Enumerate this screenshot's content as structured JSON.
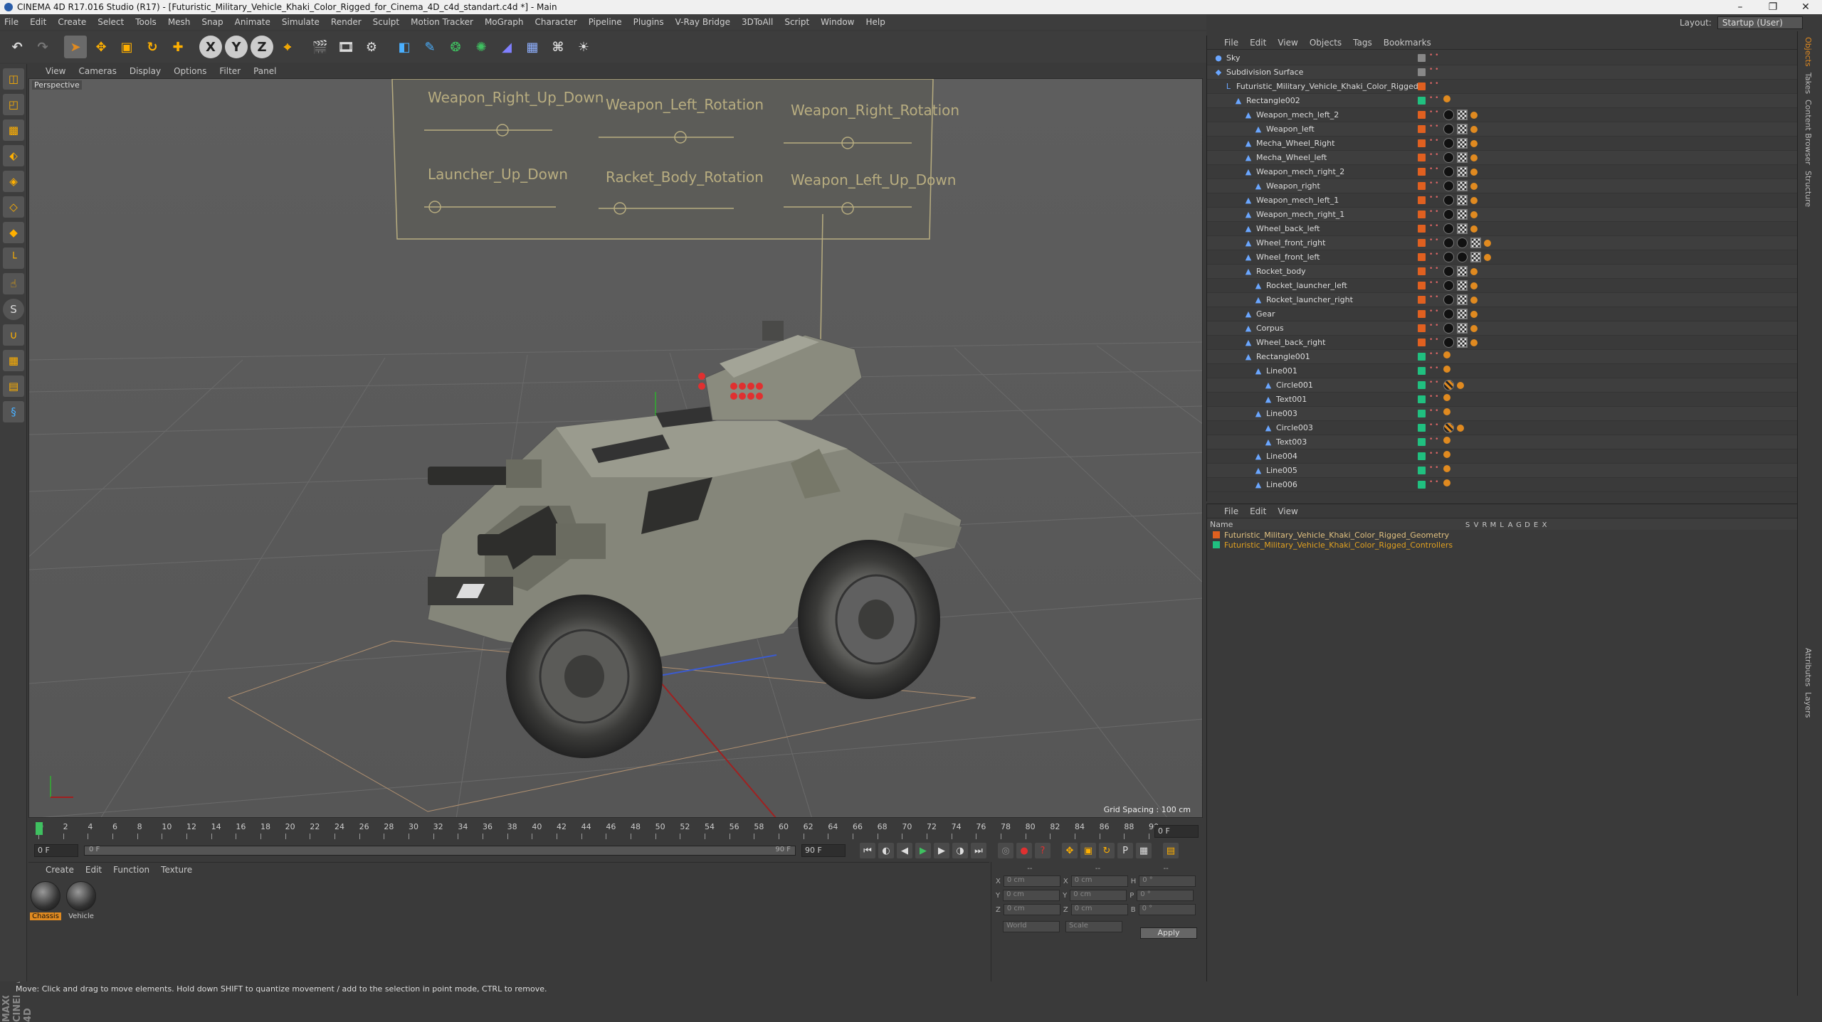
{
  "window": {
    "title": "CINEMA 4D R17.016 Studio (R17) - [Futuristic_Military_Vehicle_Khaki_Color_Rigged_for_Cinema_4D_c4d_standart.c4d *] - Main",
    "controls": [
      "–",
      "❐",
      "✕"
    ]
  },
  "menubar": [
    "File",
    "Edit",
    "Create",
    "Select",
    "Tools",
    "Mesh",
    "Snap",
    "Animate",
    "Simulate",
    "Render",
    "Sculpt",
    "Motion Tracker",
    "MoGraph",
    "Character",
    "Pipeline",
    "Plugins",
    "V-Ray Bridge",
    "3DToAll",
    "Script",
    "Window",
    "Help"
  ],
  "layout": {
    "label": "Layout:",
    "value": "Startup (User)"
  },
  "toolbar": {
    "buttons": [
      "undo-icon",
      "redo-icon",
      "select-icon",
      "move-icon",
      "scale-icon",
      "rotate-icon",
      "create-icon",
      "x-axis-icon",
      "y-axis-icon",
      "z-axis-icon",
      "world-icon",
      "render-view-icon",
      "render-pic-icon",
      "render-settings-icon",
      "cube-icon",
      "pen-icon",
      "subdivide-icon",
      "array-icon",
      "deformer-icon",
      "floor-icon",
      "camera-icon",
      "light-icon"
    ],
    "axis_labels": [
      "X",
      "Y",
      "Z"
    ]
  },
  "viewport": {
    "menu": [
      "View",
      "Cameras",
      "Display",
      "Options",
      "Filter",
      "Panel"
    ],
    "label": "Perspective",
    "grid_spacing": "Grid Spacing : 100 cm",
    "hud_controls": [
      "Weapon_Right_Up_Down",
      "Weapon_Left_Rotation",
      "Weapon_Right_Rotation",
      "Launcher_Up_Down",
      "Racket_Body_Rotation",
      "Weapon_Left_Up_Down"
    ]
  },
  "timeline": {
    "ticks": [
      "0",
      "2",
      "4",
      "6",
      "8",
      "10",
      "12",
      "14",
      "16",
      "18",
      "20",
      "22",
      "24",
      "26",
      "28",
      "30",
      "32",
      "34",
      "36",
      "38",
      "40",
      "42",
      "44",
      "46",
      "48",
      "50",
      "52",
      "54",
      "56",
      "58",
      "60",
      "62",
      "64",
      "66",
      "68",
      "70",
      "72",
      "74",
      "76",
      "78",
      "80",
      "82",
      "84",
      "86",
      "88",
      "90"
    ],
    "current_frame": "0 F",
    "start_frame": "0 F",
    "range_start": "0 F",
    "range_end": "90 F",
    "end_frame": "90 F"
  },
  "materials": {
    "menu": [
      "Create",
      "Edit",
      "Function",
      "Texture"
    ],
    "items": [
      {
        "name": "Chassis",
        "selected": true
      },
      {
        "name": "Vehicle",
        "selected": false
      }
    ]
  },
  "coordinates": {
    "header": [
      "--",
      "--",
      "--"
    ],
    "rows": [
      {
        "a": "X",
        "av": "0 cm",
        "b": "X",
        "bv": "0 cm",
        "c": "H",
        "cv": "0 °"
      },
      {
        "a": "Y",
        "av": "0 cm",
        "b": "Y",
        "bv": "0 cm",
        "c": "P",
        "cv": "0 °"
      },
      {
        "a": "Z",
        "av": "0 cm",
        "b": "Z",
        "bv": "0 cm",
        "c": "B",
        "cv": "0 °"
      }
    ],
    "mode1": "World",
    "mode2": "Scale",
    "apply": "Apply"
  },
  "status": "Move: Click and drag to move elements. Hold down SHIFT to quantize movement / add to the selection in point mode, CTRL to remove.",
  "object_manager": {
    "menu": [
      "File",
      "Edit",
      "View",
      "Objects",
      "Tags",
      "Bookmarks"
    ],
    "objects": [
      {
        "name": "Sky",
        "indent": 0,
        "icon": "●",
        "vis": "#888",
        "tags": []
      },
      {
        "name": "Subdivision Surface",
        "indent": 0,
        "icon": "◆",
        "vis": "#888",
        "tags": []
      },
      {
        "name": "Futuristic_Military_Vehicle_Khaki_Color_Rigged",
        "indent": 1,
        "icon": "L",
        "vis": "#e06020",
        "tags": []
      },
      {
        "name": "Rectangle002",
        "indent": 2,
        "icon": "▲",
        "vis": "#20c080",
        "tags": [
          "orange"
        ]
      },
      {
        "name": "Weapon_mech_left_2",
        "indent": 3,
        "icon": "▲",
        "vis": "#e06020",
        "tags": [
          "ball",
          "check",
          "orange"
        ]
      },
      {
        "name": "Weapon_left",
        "indent": 4,
        "icon": "▲",
        "vis": "#e06020",
        "tags": [
          "ball",
          "check",
          "orange"
        ]
      },
      {
        "name": "Mecha_Wheel_Right",
        "indent": 3,
        "icon": "▲",
        "vis": "#e06020",
        "tags": [
          "ball",
          "check",
          "orange"
        ]
      },
      {
        "name": "Mecha_Wheel_left",
        "indent": 3,
        "icon": "▲",
        "vis": "#e06020",
        "tags": [
          "ball",
          "check",
          "orange"
        ]
      },
      {
        "name": "Weapon_mech_right_2",
        "indent": 3,
        "icon": "▲",
        "vis": "#e06020",
        "tags": [
          "ball",
          "check",
          "orange"
        ]
      },
      {
        "name": "Weapon_right",
        "indent": 4,
        "icon": "▲",
        "vis": "#e06020",
        "tags": [
          "ball",
          "check",
          "orange"
        ]
      },
      {
        "name": "Weapon_mech_left_1",
        "indent": 3,
        "icon": "▲",
        "vis": "#e06020",
        "tags": [
          "ball",
          "check",
          "orange"
        ]
      },
      {
        "name": "Weapon_mech_right_1",
        "indent": 3,
        "icon": "▲",
        "vis": "#e06020",
        "tags": [
          "ball",
          "check",
          "orange"
        ]
      },
      {
        "name": "Wheel_back_left",
        "indent": 3,
        "icon": "▲",
        "vis": "#e06020",
        "tags": [
          "ball",
          "check",
          "orange"
        ]
      },
      {
        "name": "Wheel_front_right",
        "indent": 3,
        "icon": "▲",
        "vis": "#e06020",
        "tags": [
          "ball",
          "ball",
          "check",
          "orange"
        ]
      },
      {
        "name": "Wheel_front_left",
        "indent": 3,
        "icon": "▲",
        "vis": "#e06020",
        "tags": [
          "ball",
          "ball",
          "check",
          "orange"
        ]
      },
      {
        "name": "Rocket_body",
        "indent": 3,
        "icon": "▲",
        "vis": "#e06020",
        "tags": [
          "ball",
          "check",
          "orange"
        ]
      },
      {
        "name": "Rocket_launcher_left",
        "indent": 4,
        "icon": "▲",
        "vis": "#e06020",
        "tags": [
          "ball",
          "check",
          "orange"
        ]
      },
      {
        "name": "Rocket_launcher_right",
        "indent": 4,
        "icon": "▲",
        "vis": "#e06020",
        "tags": [
          "ball",
          "check",
          "orange"
        ]
      },
      {
        "name": "Gear",
        "indent": 3,
        "icon": "▲",
        "vis": "#e06020",
        "tags": [
          "ball",
          "check",
          "orange"
        ]
      },
      {
        "name": "Corpus",
        "indent": 3,
        "icon": "▲",
        "vis": "#e06020",
        "tags": [
          "ball",
          "check",
          "orange"
        ]
      },
      {
        "name": "Wheel_back_right",
        "indent": 3,
        "icon": "▲",
        "vis": "#e06020",
        "tags": [
          "ball",
          "check",
          "orange"
        ]
      },
      {
        "name": "Rectangle001",
        "indent": 3,
        "icon": "▲",
        "vis": "#20c080",
        "tags": [
          "orange"
        ]
      },
      {
        "name": "Line001",
        "indent": 4,
        "icon": "▲",
        "vis": "#20c080",
        "tags": [
          "orange"
        ]
      },
      {
        "name": "Circle001",
        "indent": 5,
        "icon": "▲",
        "vis": "#20c080",
        "tags": [
          "stripe",
          "orange"
        ]
      },
      {
        "name": "Text001",
        "indent": 5,
        "icon": "▲",
        "vis": "#20c080",
        "tags": [
          "orange"
        ]
      },
      {
        "name": "Line003",
        "indent": 4,
        "icon": "▲",
        "vis": "#20c080",
        "tags": [
          "orange"
        ]
      },
      {
        "name": "Circle003",
        "indent": 5,
        "icon": "▲",
        "vis": "#20c080",
        "tags": [
          "stripe",
          "orange"
        ]
      },
      {
        "name": "Text003",
        "indent": 5,
        "icon": "▲",
        "vis": "#20c080",
        "tags": [
          "orange"
        ]
      },
      {
        "name": "Line004",
        "indent": 4,
        "icon": "▲",
        "vis": "#20c080",
        "tags": [
          "orange"
        ]
      },
      {
        "name": "Line005",
        "indent": 4,
        "icon": "▲",
        "vis": "#20c080",
        "tags": [
          "orange"
        ]
      },
      {
        "name": "Line006",
        "indent": 4,
        "icon": "▲",
        "vis": "#20c080",
        "tags": [
          "orange"
        ]
      }
    ]
  },
  "layer_manager": {
    "menu": [
      "File",
      "Edit",
      "View"
    ],
    "header_name": "Name",
    "columns": [
      "S",
      "V",
      "R",
      "M",
      "L",
      "A",
      "G",
      "D",
      "E",
      "X"
    ],
    "layers": [
      {
        "name": "Futuristic_Military_Vehicle_Khaki_Color_Rigged_Geometry",
        "color": "#e06020",
        "text_color": "#e0c080"
      },
      {
        "name": "Futuristic_Military_Vehicle_Khaki_Color_Rigged_Controllers",
        "color": "#20c080",
        "text_color": "#e0a020"
      }
    ]
  },
  "side_tabs": [
    "Objects",
    "Takes",
    "Content Browser",
    "Structure",
    "Attributes",
    "Layers"
  ]
}
